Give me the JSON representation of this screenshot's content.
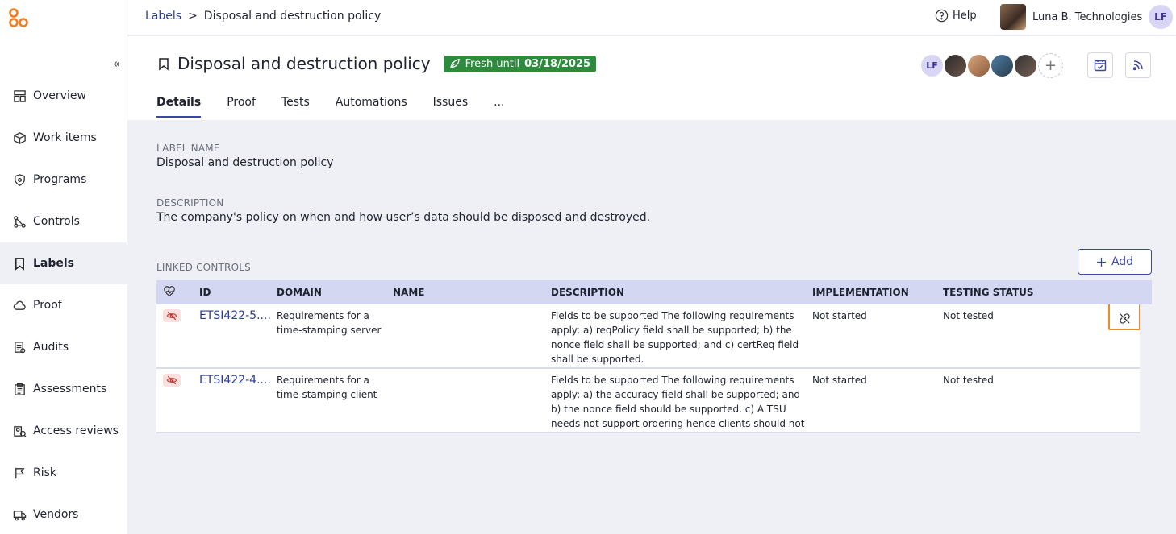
{
  "sidebar": {
    "items": [
      {
        "label": "Overview",
        "icon": "overview-icon"
      },
      {
        "label": "Work items",
        "icon": "box-icon"
      },
      {
        "label": "Programs",
        "icon": "shield-icon"
      },
      {
        "label": "Controls",
        "icon": "nodes-icon"
      },
      {
        "label": "Labels",
        "icon": "label-icon",
        "active": true
      },
      {
        "label": "Proof",
        "icon": "cloud-icon"
      },
      {
        "label": "Audits",
        "icon": "audit-icon"
      },
      {
        "label": "Assessments",
        "icon": "clipboard-icon"
      },
      {
        "label": "Access reviews",
        "icon": "access-icon"
      },
      {
        "label": "Risk",
        "icon": "flag-icon"
      },
      {
        "label": "Vendors",
        "icon": "truck-icon"
      }
    ],
    "collapse_label": "«"
  },
  "topbar": {
    "breadcrumb_root": "Labels",
    "breadcrumb_sep": ">",
    "breadcrumb_current": "Disposal and destruction policy",
    "help_label": "Help",
    "org_name": "Luna B. Technologies",
    "user_initials": "LF"
  },
  "header": {
    "title": "Disposal and destruction policy",
    "fresh_prefix": "Fresh until",
    "fresh_date": "03/18/2025",
    "people_initials": "LF",
    "add_person": "+",
    "tabs": [
      "Details",
      "Proof",
      "Tests",
      "Automations",
      "Issues",
      "..."
    ]
  },
  "details": {
    "label_name_title": "LABEL NAME",
    "label_name": "Disposal and destruction policy",
    "description_title": "DESCRIPTION",
    "description": "The company's policy on when and how user’s data should be disposed and destroyed.",
    "linked_title": "LINKED CONTROLS",
    "add_label": "Add"
  },
  "table": {
    "headers": {
      "id": "ID",
      "domain": "DOMAIN",
      "name": "NAME",
      "description": "DESCRIPTION",
      "implementation": "IMPLEMENTATION",
      "testing": "TESTING STATUS"
    },
    "rows": [
      {
        "id": "ETSI422-5....",
        "domain": "Requirements for a time-stamping server",
        "name": "",
        "description": "Fields to be supported The following requirements apply: a) reqPolicy field shall be supported; b) the nonce field shall be supported; and c) certReq field shall be supported.",
        "implementation": "Not started",
        "testing": "Not tested"
      },
      {
        "id": "ETSI422-4....",
        "domain": "Requirements for a time-stamping client",
        "name": "",
        "description": "Fields to be supported The following requirements apply: a) the accuracy field shall be supported; and b) the nonce field should be supported. c) A TSU needs not support ordering hence clients should not depend on the ordering of responses. d) the tsa field",
        "implementation": "Not started",
        "testing": "Not tested"
      }
    ]
  },
  "colors": {
    "accent": "#3b47a8",
    "fresh": "#2e8b3e",
    "highlight": "#f08a24",
    "logo": "#f47b20"
  }
}
